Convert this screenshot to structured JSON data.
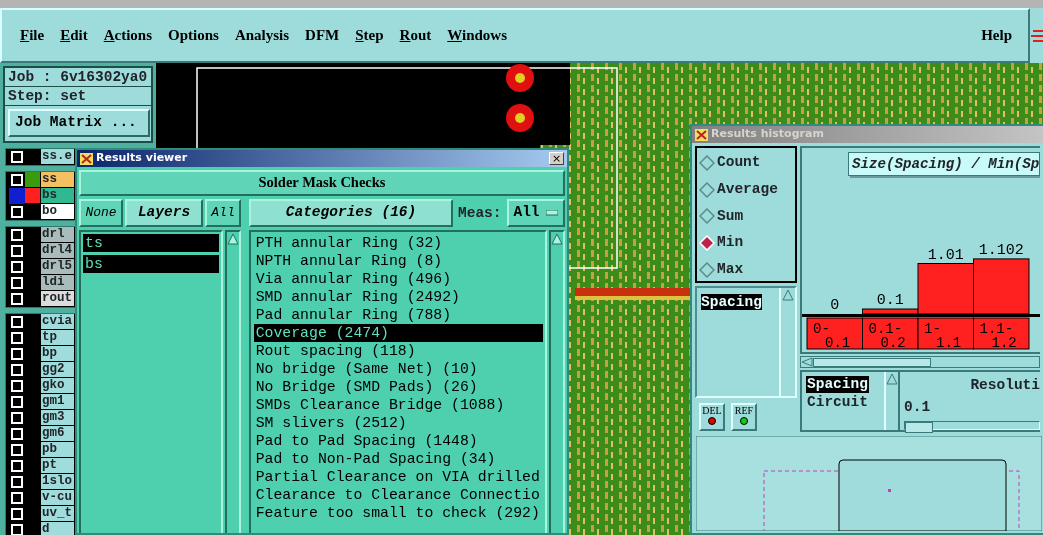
{
  "menu": {
    "items": [
      {
        "label": "File",
        "mnemonic": true
      },
      {
        "label": "Edit",
        "mnemonic": true
      },
      {
        "label": "Actions",
        "mnemonic": true
      },
      {
        "label": "Options",
        "mnemonic": false
      },
      {
        "label": "Analysis",
        "mnemonic": false
      },
      {
        "label": "DFM",
        "mnemonic": false
      },
      {
        "label": "Step",
        "mnemonic": true
      },
      {
        "label": "Rout",
        "mnemonic": true
      },
      {
        "label": "Windows",
        "mnemonic": true
      }
    ],
    "help": {
      "label": "Help",
      "mnemonic": false
    }
  },
  "job_panel": {
    "job": "Job : 6v16302ya0",
    "step": "Step: set",
    "matrix_button": "Job Matrix ..."
  },
  "layer_groups": [
    {
      "layers": [
        {
          "name": "ss.e",
          "color": "#a0dcdc",
          "selected": false
        }
      ]
    },
    {
      "layers": [
        {
          "name": "ss",
          "color": "#f5c060",
          "swatch": {
            "color": "#3a9a10"
          },
          "selected": false
        },
        {
          "name": "bs",
          "color": "#30b890",
          "swatch": {
            "color": "#ff2020"
          },
          "selected": true
        },
        {
          "name": "bo",
          "color": "#ffffff",
          "selected": false
        }
      ]
    },
    {
      "layers": [
        {
          "name": "drl",
          "color": "#a8bcbc",
          "selected": false
        },
        {
          "name": "drl4",
          "color": "#a8bcbc",
          "selected": false
        },
        {
          "name": "drl5",
          "color": "#a8bcbc",
          "selected": false
        },
        {
          "name": "ldi",
          "color": "#a8bcbc",
          "selected": false
        },
        {
          "name": "rout",
          "color": "#dcdcdc",
          "selected": false
        }
      ]
    },
    {
      "layers": [
        {
          "name": "cvia",
          "color": "#a0dcdc",
          "selected": false
        },
        {
          "name": "tp",
          "color": "#a0dcdc",
          "selected": false
        },
        {
          "name": "bp",
          "color": "#a0dcdc",
          "selected": false
        },
        {
          "name": "gg2",
          "color": "#a0dcdc",
          "selected": false
        },
        {
          "name": "gko",
          "color": "#a0dcdc",
          "selected": false
        },
        {
          "name": "gm1",
          "color": "#a0dcdc",
          "selected": false
        },
        {
          "name": "gm3",
          "color": "#a0dcdc",
          "selected": false
        },
        {
          "name": "gm6",
          "color": "#a0dcdc",
          "selected": false
        },
        {
          "name": "pb",
          "color": "#a0dcdc",
          "selected": false
        },
        {
          "name": "pt",
          "color": "#a0dcdc",
          "selected": false
        },
        {
          "name": "1slo",
          "color": "#a0dcdc",
          "selected": false
        },
        {
          "name": "v-cu",
          "color": "#a0dcdc",
          "selected": false
        },
        {
          "name": "uv_t",
          "color": "#a0dcdc",
          "selected": false
        },
        {
          "name": "d",
          "color": "#a0dcdc",
          "selected": false
        }
      ]
    }
  ],
  "results_viewer": {
    "title": "Results viewer",
    "close": "×",
    "heading": "Solder Mask Checks",
    "none_button": "None",
    "layers_button": "Layers",
    "all_button": "All",
    "categories_header": "Categories (16)",
    "meas_label": "Meas:",
    "meas_value": "All",
    "layers": [
      {
        "name": "ts",
        "selected": true
      },
      {
        "name": "bs",
        "selected": true
      }
    ],
    "categories": [
      {
        "label": "PTH annular Ring (32)",
        "selected": false
      },
      {
        "label": "NPTH annular Ring (8)",
        "selected": false
      },
      {
        "label": "Via annular Ring (496)",
        "selected": false
      },
      {
        "label": "SMD annular Ring (2492)",
        "selected": false
      },
      {
        "label": "Pad annular Ring (788)",
        "selected": false
      },
      {
        "label": "Coverage (2474)",
        "selected": true
      },
      {
        "label": "Rout spacing (118)",
        "selected": false
      },
      {
        "label": "No bridge (Same Net) (10)",
        "selected": false
      },
      {
        "label": "No Bridge (SMD Pads) (26)",
        "selected": false
      },
      {
        "label": "SMDs Clearance Bridge (1088)",
        "selected": false
      },
      {
        "label": "SM slivers (2512)",
        "selected": false
      },
      {
        "label": "Pad to Pad Spacing (1448)",
        "selected": false
      },
      {
        "label": "Pad to Non-Pad Spacing (34)",
        "selected": false
      },
      {
        "label": "Partial Clearance on VIA drilled",
        "selected": false
      },
      {
        "label": "Clearance to Clearance Connectio",
        "selected": false
      },
      {
        "label": "Feature too small to check (292)",
        "selected": false
      }
    ]
  },
  "results_histogram": {
    "title": "Results histogram",
    "modes": [
      {
        "label": "Count",
        "selected": false
      },
      {
        "label": "Average",
        "selected": false
      },
      {
        "label": "Sum",
        "selected": false
      },
      {
        "label": "Min",
        "selected": true
      },
      {
        "label": "Max",
        "selected": false
      }
    ],
    "fields": [
      {
        "label": "Spacing",
        "selected": true
      }
    ],
    "buttons": [
      {
        "label": "DEL",
        "color": "#e00000"
      },
      {
        "label": "REF",
        "color": "#10d010"
      }
    ],
    "chart_data": {
      "type": "bar",
      "title": "Size(Spacing) / Min(Sp",
      "categories": [
        "0-0.1",
        "0.1-0.2",
        "1-1.1",
        "1.1-1.2"
      ],
      "series": [
        {
          "color": "#ff2020",
          "values": [
            0,
            0.1,
            1.01,
            1.102
          ]
        }
      ],
      "data_labels": true
    },
    "attributes": [
      {
        "label": "Spacing",
        "selected": true
      },
      {
        "label": "Circuit",
        "selected": false
      }
    ],
    "resolution_label": "Resoluti",
    "resolution_value": "0.1",
    "resolution_slider": {
      "level": 0
    }
  }
}
